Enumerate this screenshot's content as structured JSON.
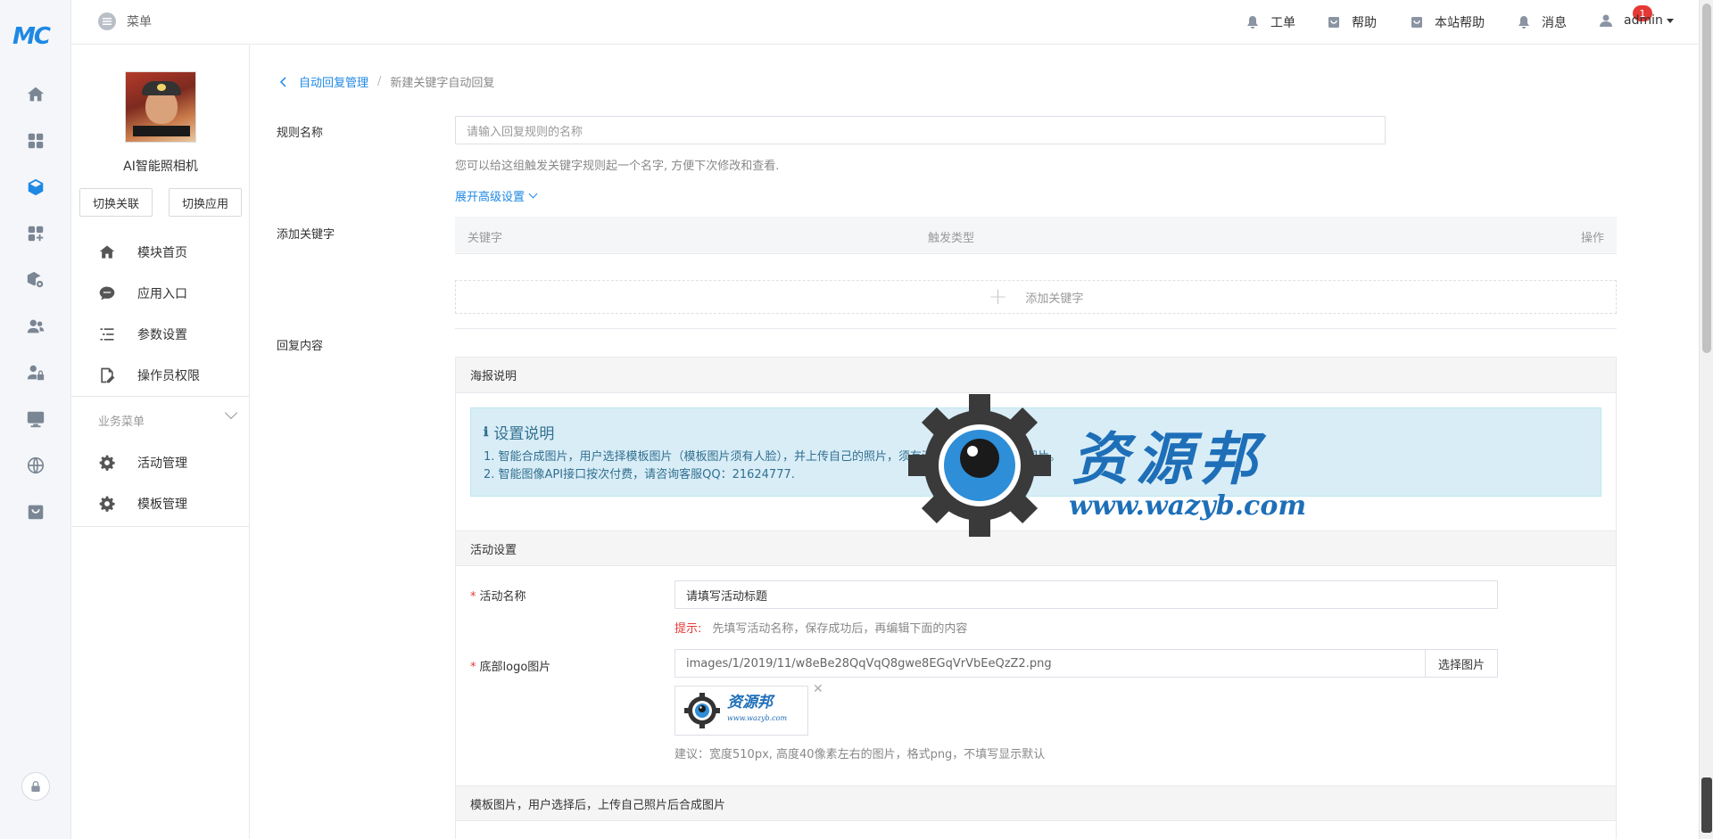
{
  "rail": {
    "logo": "MC",
    "icons": [
      "home-icon",
      "apps-icon",
      "cube-icon",
      "grid-plus-icon",
      "box-gear-icon",
      "users-icon",
      "user-lock-icon",
      "monitor-icon",
      "globe-icon",
      "bag-icon"
    ],
    "active_index": 2
  },
  "topbar": {
    "menu_label": "菜单",
    "ticket": "工单",
    "help": "帮助",
    "site_help": "本站帮助",
    "messages": "消息",
    "message_count": "1",
    "user": "admin"
  },
  "sidebar": {
    "app_name": "AI智能照相机",
    "switch_link": "切换关联",
    "switch_app": "切换应用",
    "items": [
      {
        "label": "模块首页",
        "icon": "home-icon"
      },
      {
        "label": "应用入口",
        "icon": "chat-icon"
      },
      {
        "label": "参数设置",
        "icon": "list-icon"
      },
      {
        "label": "操作员权限",
        "icon": "edit-doc-icon"
      }
    ],
    "biz_title": "业务菜单",
    "biz_items": [
      {
        "label": "活动管理",
        "icon": "gear-icon"
      },
      {
        "label": "模板管理",
        "icon": "gear-icon"
      }
    ]
  },
  "breadcrumb": {
    "parent": "自动回复管理",
    "separator": "/",
    "current": "新建关键字自动回复"
  },
  "form": {
    "rule_label": "规则名称",
    "rule_placeholder": "请输入回复规则的名称",
    "rule_hint": "您可以给这组触发关键字规则起一个名字, 方便下次修改和查看.",
    "expand_label": "展开高级设置",
    "keyword_label": "添加关键字",
    "kw_columns": [
      "关键字",
      "触发类型",
      "操作"
    ],
    "add_keyword": "添加关键字",
    "reply_label": "回复内容"
  },
  "panel": {
    "poster_title": "海报说明",
    "notice_title": "设置说明",
    "notice_lines": [
      "1. 智能合成图片，用户选择模板图片（模板图片须有人脸），并上传自己的照片，须有清晰人脸，即可合成图片。",
      "2. 智能图像API接口按次付费，请咨询客服QQ：21624777."
    ],
    "activity_title": "活动设置",
    "activity_name_label": "活动名称",
    "activity_name_value": "请填写活动标题",
    "tip_key": "提示:",
    "tip_value": "先填写活动名称，保存成功后，再编辑下面的内容",
    "logo_label": "底部logo图片",
    "logo_path": "images/1/2019/11/w8eBe28QqVqQ8gwe8EGqVrVbEeQzZ2.png",
    "select_image": "选择图片",
    "logo_suggest": "建议：宽度510px, 高度40像素左右的图片，格式png，不填写显示默认",
    "template_title": "模板图片，用户选择后，上传自己照片后合成图片"
  },
  "watermark": {
    "text": "资源邦",
    "url": "www.wazyb.com"
  },
  "colors": {
    "accent": "#1e88e5",
    "required": "#e53935",
    "notice_bg": "#d9edf7",
    "notice_text": "#31708f"
  }
}
